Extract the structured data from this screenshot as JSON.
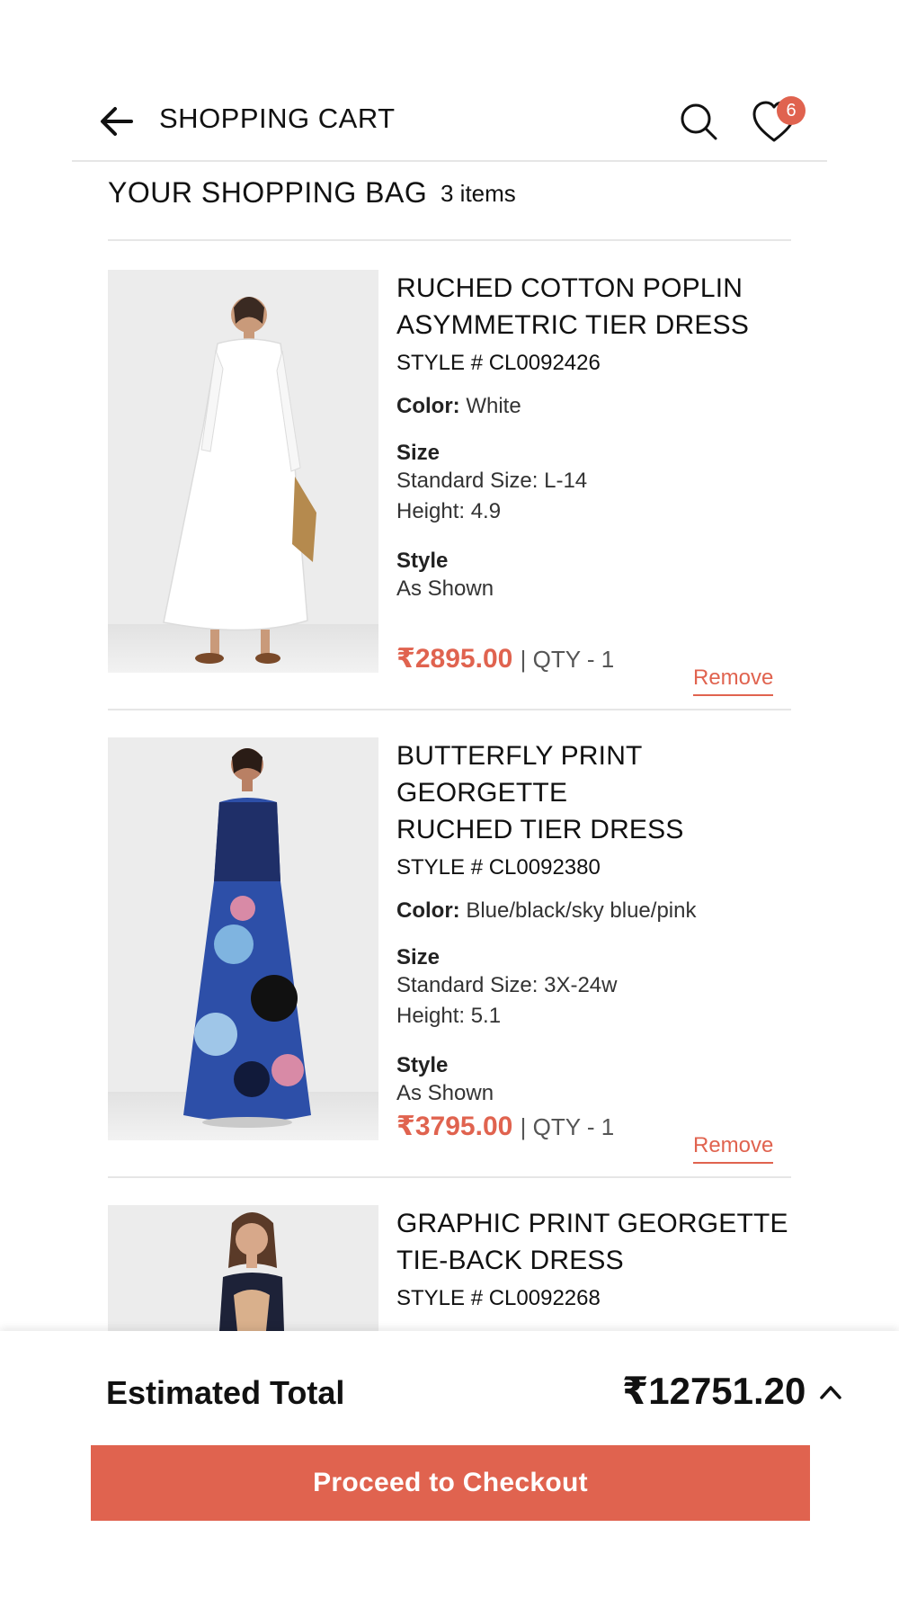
{
  "header": {
    "title": "SHOPPING CART",
    "wishlist_count": "6"
  },
  "bag": {
    "title": "YOUR SHOPPING BAG",
    "count": "3 items"
  },
  "items": [
    {
      "name_line1": "RUCHED COTTON POPLIN",
      "name_line2": "ASYMMETRIC TIER DRESS",
      "style_no": "STYLE # CL0092426",
      "color_label": "Color:",
      "color": "White",
      "size_label": "Size",
      "size": "Standard Size: L-14",
      "height": "Height: 4.9",
      "style_label": "Style",
      "style": "As Shown",
      "price": "₹2895.00",
      "qty": "QTY - 1",
      "remove": "Remove",
      "dress_color": "#ffffff"
    },
    {
      "name_line1": "BUTTERFLY PRINT GEORGETTE",
      "name_line2": "RUCHED TIER DRESS",
      "style_no": "STYLE # CL0092380",
      "color_label": "Color:",
      "color": "Blue/black/sky blue/pink",
      "size_label": "Size",
      "size": "Standard Size: 3X-24w",
      "height": "Height: 5.1",
      "style_label": "Style",
      "style": "As Shown",
      "price": "₹3795.00",
      "qty": "QTY - 1",
      "remove": "Remove",
      "dress_color": "#2d4fa8"
    },
    {
      "name_line1": "GRAPHIC PRINT GEORGETTE",
      "name_line2": "TIE-BACK DRESS",
      "style_no": "STYLE # CL0092268",
      "dress_color": "#1d2238"
    }
  ],
  "summary": {
    "label": "Estimated Total",
    "total": "₹12751.20",
    "checkout_label": "Proceed to Checkout"
  },
  "colors": {
    "accent": "#e0634f",
    "divider": "#e6e6e6"
  }
}
